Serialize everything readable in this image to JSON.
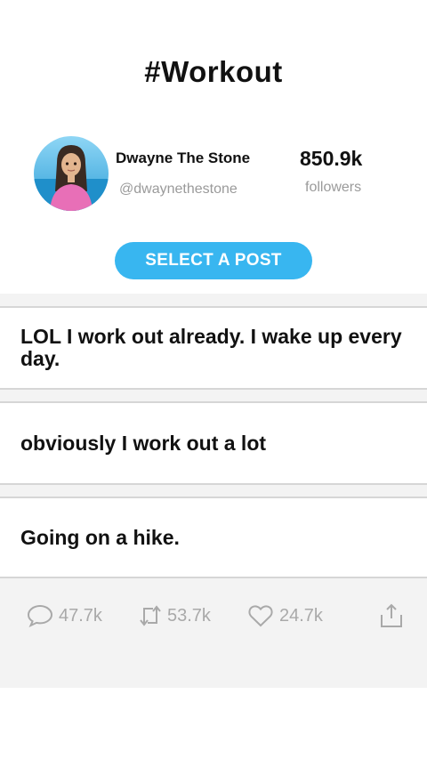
{
  "header": {
    "title": "#Workout"
  },
  "profile": {
    "name": "Dwayne The Stone",
    "handle": "@dwaynethestone",
    "followers_count": "850.9k",
    "followers_label": "followers"
  },
  "select_button": {
    "label": "SELECT A POST"
  },
  "posts": [
    {
      "text": "LOL I work out already. I wake up every day."
    },
    {
      "text": "obviously I work out a lot"
    },
    {
      "text": "Going on a hike."
    }
  ],
  "actions": {
    "replies": "47.7k",
    "retweets": "53.7k",
    "likes": "24.7k"
  },
  "colors": {
    "accent": "#38b6f0",
    "muted_text": "#9a9a9a",
    "divider": "#d6d6d6",
    "panel_bg": "#f3f3f3"
  }
}
